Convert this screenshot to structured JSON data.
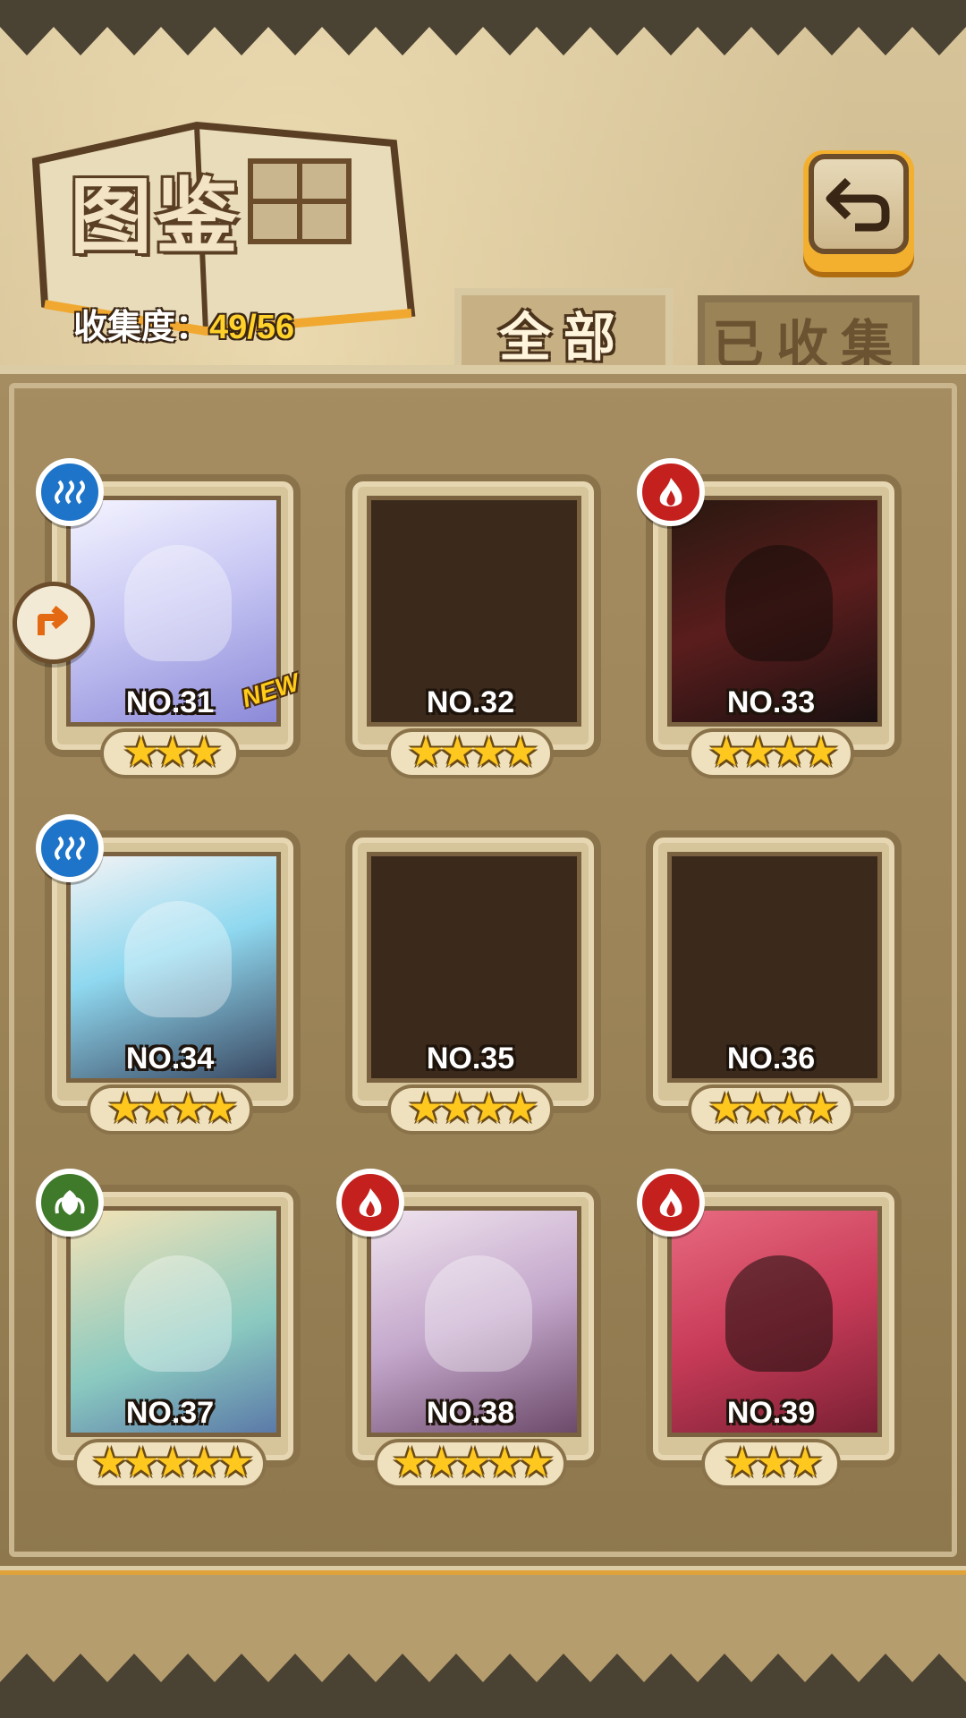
{
  "header": {
    "title": "图鉴",
    "collection_label": "收集度：",
    "collection_value": "49/56"
  },
  "tabs": [
    {
      "label": "全部",
      "active": true
    },
    {
      "label": "已收集",
      "active": false
    }
  ],
  "icons": {
    "back": "back-arrow-icon",
    "side": "share-arrow-icon"
  },
  "cards": [
    {
      "number": "NO.31",
      "stars": 3,
      "stars_text": "★★★",
      "element": "water",
      "unlocked": true,
      "new_badge": "NEW"
    },
    {
      "number": "NO.32",
      "stars": 4,
      "stars_text": "★★★★",
      "element": "",
      "unlocked": false
    },
    {
      "number": "NO.33",
      "stars": 4,
      "stars_text": "★★★★",
      "element": "fire",
      "unlocked": true
    },
    {
      "number": "NO.34",
      "stars": 4,
      "stars_text": "★★★★",
      "element": "water",
      "unlocked": true
    },
    {
      "number": "NO.35",
      "stars": 4,
      "stars_text": "★★★★",
      "element": "",
      "unlocked": false
    },
    {
      "number": "NO.36",
      "stars": 4,
      "stars_text": "★★★★",
      "element": "",
      "unlocked": false
    },
    {
      "number": "NO.37",
      "stars": 5,
      "stars_text": "★★★★★",
      "element": "leaf",
      "unlocked": true
    },
    {
      "number": "NO.38",
      "stars": 5,
      "stars_text": "★★★★★",
      "element": "fire",
      "unlocked": true
    },
    {
      "number": "NO.39",
      "stars": 3,
      "stars_text": "★★★",
      "element": "fire",
      "unlocked": true
    }
  ],
  "colors": {
    "accent_gold": "#ffd12a",
    "water": "#1e74c8",
    "fire": "#c4201d",
    "leaf": "#3f7a2a"
  }
}
